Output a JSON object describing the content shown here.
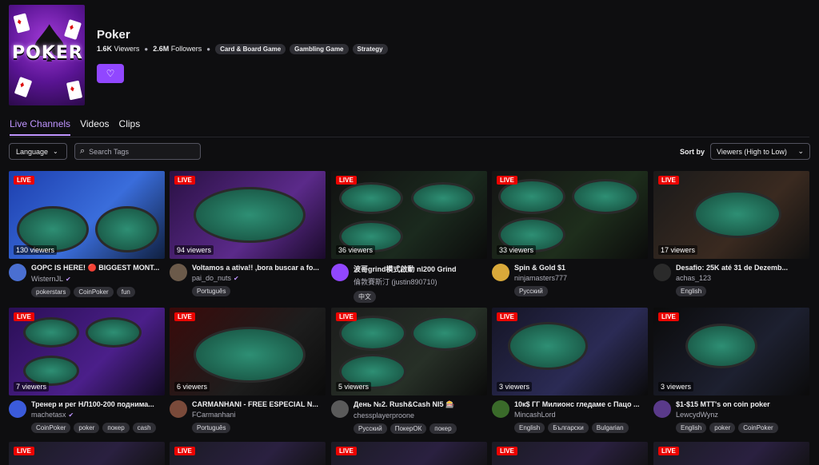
{
  "category": {
    "name": "Poker",
    "logo_text": "POKER",
    "viewers": "1.6K",
    "viewers_label": "Viewers",
    "followers": "2.6M",
    "followers_label": "Followers",
    "tags": [
      "Card & Board Game",
      "Gambling Game",
      "Strategy"
    ]
  },
  "tabs": [
    "Live Channels",
    "Videos",
    "Clips"
  ],
  "filters": {
    "language_label": "Language",
    "search_placeholder": "Search Tags",
    "sort_label": "Sort by",
    "sort_value": "Viewers (High to Low)"
  },
  "live_badge": "LIVE",
  "streams": [
    {
      "title": "GOPC IS HERE! 🔴 BIGGEST MONT...",
      "channel": "WisternJL",
      "verified": true,
      "viewers": "130 viewers",
      "tags": [
        "pokerstars",
        "CoinPoker",
        "fun"
      ],
      "avatar_color": "#4a6fd1"
    },
    {
      "title": "Voltamos a ativa!! ,bora buscar a fo...",
      "channel": "pai_do_nuts",
      "verified": true,
      "viewers": "94 viewers",
      "tags": [
        "Português"
      ],
      "avatar_color": "#6b5a4a"
    },
    {
      "title": "波哥grind模式啟動 nl200 Grind",
      "channel": "倫敦賽斯汀 (justin890710)",
      "verified": false,
      "viewers": "36 viewers",
      "tags": [
        "中文"
      ],
      "avatar_color": "#9147ff"
    },
    {
      "title": "Spin & Gold $1",
      "channel": "ninjamasters777",
      "verified": false,
      "viewers": "33 viewers",
      "tags": [
        "Русский"
      ],
      "avatar_color": "#d9a93a"
    },
    {
      "title": "Desafio: 25K até 31 de Dezemb...",
      "channel": "achas_123",
      "verified": false,
      "viewers": "17 viewers",
      "tags": [
        "English"
      ],
      "avatar_color": "#2a2a2a"
    },
    {
      "title": "Тренер и рег НЛ100-200 поднима...",
      "channel": "machetasx",
      "verified": true,
      "viewers": "7 viewers",
      "tags": [
        "CoinPoker",
        "poker",
        "покер",
        "cash"
      ],
      "avatar_color": "#3b5bdb"
    },
    {
      "title": "CARMANHANI - FREE ESPECIAL N...",
      "channel": "FCarmanhani",
      "verified": false,
      "viewers": "6 viewers",
      "tags": [
        "Português"
      ],
      "avatar_color": "#7a4a3a"
    },
    {
      "title": "День №2. Rush&Cash NI5 🎰",
      "channel": "chessplayerproone",
      "verified": false,
      "viewers": "5 viewers",
      "tags": [
        "Русский",
        "ПокерОК",
        "покер"
      ],
      "avatar_color": "#5a5a5a"
    },
    {
      "title": "10к$ ГГ Милионс гледаме с Пацо ...",
      "channel": "MincashLord",
      "verified": false,
      "viewers": "3 viewers",
      "tags": [
        "English",
        "Български",
        "Bulgarian"
      ],
      "avatar_color": "#3a6a2a"
    },
    {
      "title": "$1-$15 MTT's on coin poker",
      "channel": "LewcydWynz",
      "verified": false,
      "viewers": "3 viewers",
      "tags": [
        "English",
        "poker",
        "CoinPoker"
      ],
      "avatar_color": "#5a3a8a"
    }
  ],
  "colors": {
    "accent": "#9147ff",
    "live": "#eb0400",
    "background": "#0e0e10"
  }
}
